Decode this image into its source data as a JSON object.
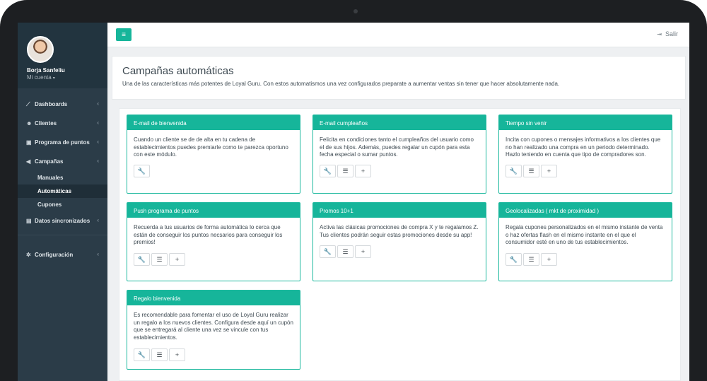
{
  "user": {
    "name": "Borja Sanfeliu",
    "account_label": "Mi cuenta"
  },
  "nav": {
    "items": [
      {
        "label": "Dashboards",
        "icon": "chart-icon"
      },
      {
        "label": "Clientes",
        "icon": "users-icon"
      },
      {
        "label": "Programa de puntos",
        "icon": "gift-icon"
      },
      {
        "label": "Campañas",
        "icon": "megaphone-icon"
      }
    ],
    "sub_items": [
      "Manuales",
      "Automáticas",
      "Cupones"
    ],
    "after_items": [
      {
        "label": "Datos sincronizados",
        "icon": "document-icon"
      }
    ],
    "settings": {
      "label": "Configuración",
      "icon": "gear-icon"
    },
    "chevron": "‹"
  },
  "topbar": {
    "logout_label": "Salir"
  },
  "header": {
    "title": "Campañas automáticas",
    "description": "Una de las características más potentes de Loyal Guru. Con estos automatismos una vez configurados preparate a aumentar ventas sin tener que hacer absolutamente nada."
  },
  "cards": [
    {
      "title": "E-mail de bienvenida",
      "body": "Cuando un cliente se de de alta en tu cadena de establecimientos puedes premiarle como te parezca oportuno con este módulo.",
      "actions": [
        "wrench-icon"
      ]
    },
    {
      "title": "E-mail cumpleaños",
      "body": "Felicita en condiciones tanto el cumpleaños del usuario como el de sus hijos. Además, puedes regalar un cupón para esta fecha especial o sumar puntos.",
      "actions": [
        "wrench-icon",
        "list-icon",
        "plus-icon"
      ]
    },
    {
      "title": "Tiempo sin venir",
      "body": "Incita con cupones o mensajes informativos a los clientes que no han realizado una compra en un periodo determinado. Hazlo teniendo en cuenta que tipo de compradores son.",
      "actions": [
        "wrench-icon",
        "list-icon",
        "plus-icon"
      ]
    },
    {
      "title": "Push programa de puntos",
      "body": "Recuerda a tus usuarios de forma automática lo cerca que están de conseguir los puntos necsarios para conseguir los premios!",
      "actions": [
        "wrench-icon",
        "list-icon",
        "plus-icon"
      ]
    },
    {
      "title": "Promos 10+1",
      "body": "Activa las clásicas promociones de compra X y te regalamos Z. Tus clientes podrán seguir estas promociones desde su app!",
      "actions": [
        "wrench-icon",
        "list-icon",
        "plus-icon"
      ]
    },
    {
      "title": "Geolocalizadas ( mkt de proximidad )",
      "body": "Regala cupones personalizados en el mismo instante de venta o haz ofertas flash en el mismo instante en el que el consumidor esté en uno de tus establecimientos.",
      "actions": [
        "wrench-icon",
        "list-icon",
        "plus-icon"
      ]
    },
    {
      "title": "Regalo bienvenida",
      "body": "Es recomendable para fomentar el uso de Loyal Guru realizar un regalo a los nuevos clientes. Configura desde aquí un cupón que se entregará al cliente una vez se vincule con tus establecimientos.",
      "actions": [
        "wrench-icon",
        "list-icon",
        "plus-icon"
      ]
    }
  ],
  "colors": {
    "accent": "#16b59a",
    "sidebar": "#2b3c48",
    "sidebar_dark": "#22343f"
  }
}
